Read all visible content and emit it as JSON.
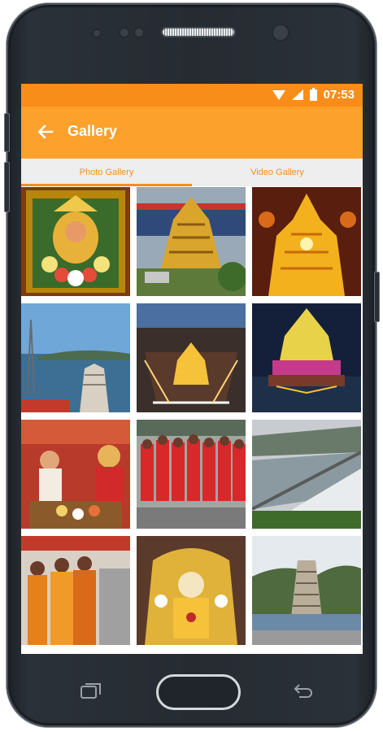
{
  "status_bar": {
    "time": "07:53",
    "icons": [
      "wifi-icon",
      "signal-icon",
      "battery-icon"
    ]
  },
  "app_bar": {
    "title": "Gallery",
    "back_icon": "arrow-left-icon"
  },
  "tabs": [
    {
      "label": "Photo Gallery",
      "selected": true
    },
    {
      "label": "Video Gallery",
      "selected": false
    }
  ],
  "colors": {
    "status_bar": "#f98d1a",
    "app_bar": "#fba12c",
    "accent": "#f98d1a",
    "tab_bar": "#eeeeee"
  },
  "gallery": {
    "photos": [
      "deity-photo",
      "temple-tower-photo",
      "illuminated-temple-photo",
      "river-temple-photo",
      "temple-night-aerial-photo",
      "temple-boat-night-photo",
      "ritual-offering-photo",
      "procession-photo",
      "river-barrage-photo",
      "women-devotees-photo",
      "decorated-idol-photo",
      "temple-gopuram-photo"
    ]
  }
}
